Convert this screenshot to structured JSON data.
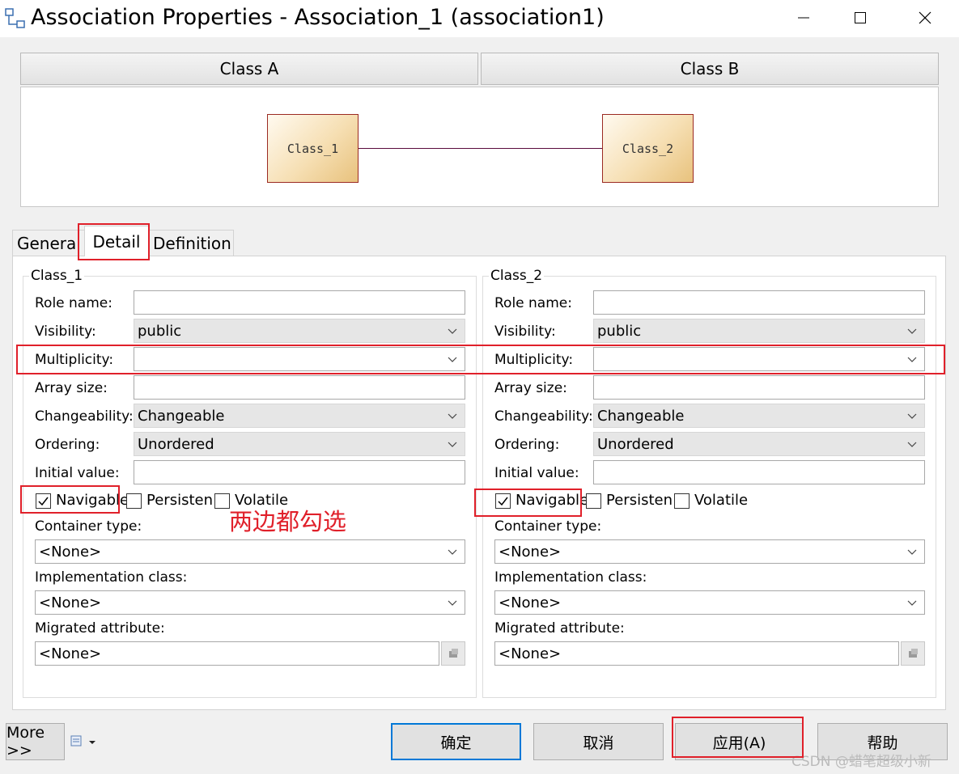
{
  "window": {
    "title": "Association Properties - Association_1 (association1)"
  },
  "headers": {
    "class_a": "Class A",
    "class_b": "Class B"
  },
  "diagram": {
    "class1": "Class_1",
    "class2": "Class_2"
  },
  "tabs": [
    {
      "label": "General",
      "active": false
    },
    {
      "label": "Detail",
      "active": true
    },
    {
      "label": "Definition",
      "active": false
    }
  ],
  "groups": [
    {
      "title": "Class_1",
      "role_name_label": "Role name:",
      "role_name_value": "",
      "visibility_label": "Visibility:",
      "visibility_value": "public",
      "multiplicity_label": "Multiplicity:",
      "multiplicity_value": "",
      "array_size_label": "Array size:",
      "array_size_value": "",
      "changeability_label": "Changeability:",
      "changeability_value": "Changeable",
      "ordering_label": "Ordering:",
      "ordering_value": "Unordered",
      "initial_value_label": "Initial value:",
      "initial_value_value": "",
      "navigable_label": "Navigable",
      "navigable_checked": true,
      "persistent_label": "Persisten",
      "persistent_checked": false,
      "volatile_label": "Volatile",
      "volatile_checked": false,
      "container_type_label": "Container type:",
      "container_type_value": "<None>",
      "implementation_class_label": "Implementation class:",
      "implementation_class_value": "<None>",
      "migrated_attribute_label": "Migrated attribute:",
      "migrated_attribute_value": "<None>"
    },
    {
      "title": "Class_2",
      "role_name_label": "Role name:",
      "role_name_value": "",
      "visibility_label": "Visibility:",
      "visibility_value": "public",
      "multiplicity_label": "Multiplicity:",
      "multiplicity_value": "",
      "array_size_label": "Array size:",
      "array_size_value": "",
      "changeability_label": "Changeability:",
      "changeability_value": "Changeable",
      "ordering_label": "Ordering:",
      "ordering_value": "Unordered",
      "initial_value_label": "Initial value:",
      "initial_value_value": "",
      "navigable_label": "Navigable",
      "navigable_checked": true,
      "persistent_label": "Persisten",
      "persistent_checked": false,
      "volatile_label": "Volatile",
      "volatile_checked": false,
      "container_type_label": "Container type:",
      "container_type_value": "<None>",
      "implementation_class_label": "Implementation class:",
      "implementation_class_value": "<None>",
      "migrated_attribute_label": "Migrated attribute:",
      "migrated_attribute_value": "<None>"
    }
  ],
  "annotation": "两边都勾选",
  "buttons": {
    "more": "More >>",
    "ok": "确定",
    "cancel": "取消",
    "apply": "应用(A)",
    "help": "帮助"
  },
  "watermark": "CSDN @蜡笔超级小新",
  "colors": {
    "annotation_red": "#e0202a",
    "default_button_border": "#0078d7",
    "association_line": "#5a0a3c"
  }
}
